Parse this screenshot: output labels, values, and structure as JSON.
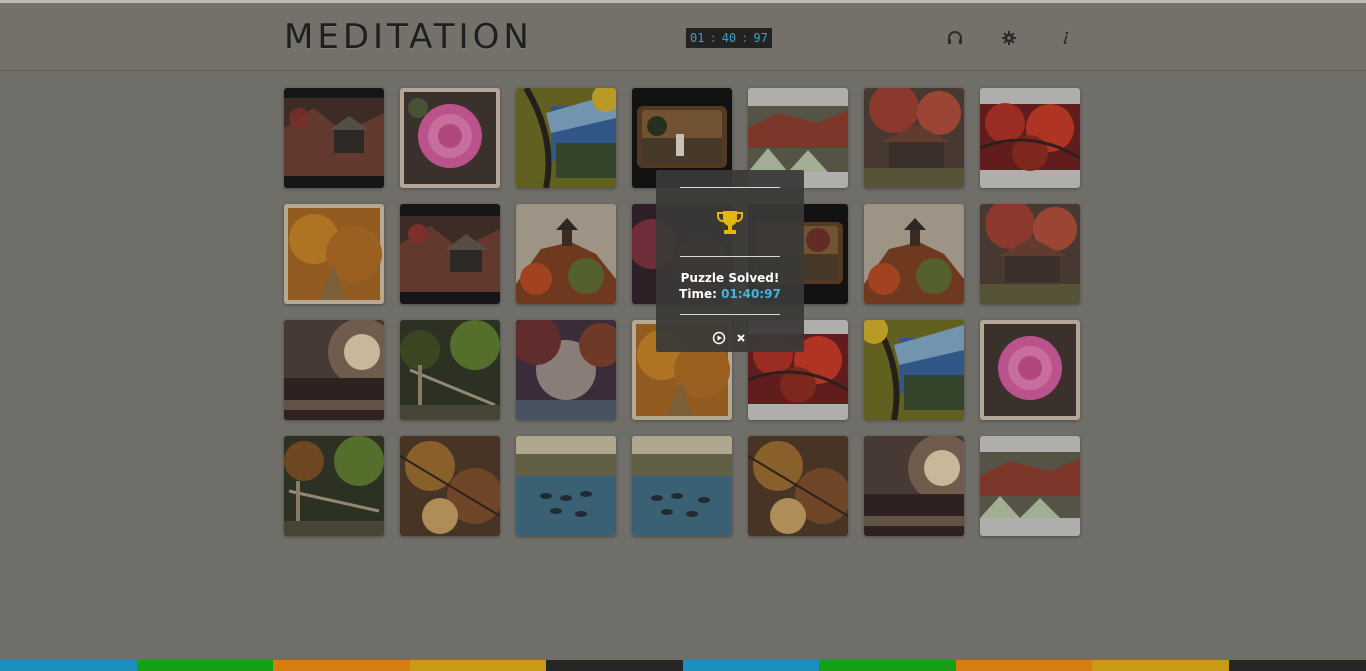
{
  "app": {
    "title": "MEDITATION"
  },
  "timer": {
    "minutes": "01",
    "seconds": "40",
    "hundredths": "97",
    "separator": ":"
  },
  "header_icons": [
    "headphones-icon",
    "gear-icon",
    "info-icon"
  ],
  "modal": {
    "icon": "trophy-icon",
    "title": "Puzzle Solved!",
    "time_label": "Time:",
    "time_value": "01:40:97",
    "buttons": [
      "replay-icon",
      "close-icon"
    ]
  },
  "board": {
    "columns": 7,
    "rows": 4,
    "tiles": [
      "dark-garden-house",
      "pink-camellia",
      "blue-pagoda-roof",
      "framed-temple-photo",
      "white-grass-landscape",
      "red-maple-hut",
      "red-maple-leaves",
      "golden-autumn-path",
      "dark-garden-house",
      "hill-pagoda",
      "framed-temple-photo",
      "framed-temple-photo",
      "hill-pagoda",
      "red-maple-hut",
      "pond-sunset",
      "forest-steps",
      "sunlit-garden",
      "golden-autumn-path",
      "red-maple-leaves",
      "blue-pagoda-roof",
      "pink-camellia",
      "forest-steps",
      "maple-branches",
      "duck-pond",
      "duck-pond",
      "maple-branches",
      "pond-sunset",
      "white-grass-landscape"
    ]
  },
  "colors": {
    "accent": "#3fb6e0",
    "background": "#7c7a73",
    "modal_background": "#3a3937",
    "trophy": "#e4b70f",
    "footer_stripes": [
      "#1c8fbf",
      "#15a016",
      "#d57d11",
      "#c99a16",
      "#262626",
      "#1c8fbf",
      "#15a016",
      "#d57d11",
      "#c99a16",
      "#262626"
    ]
  }
}
